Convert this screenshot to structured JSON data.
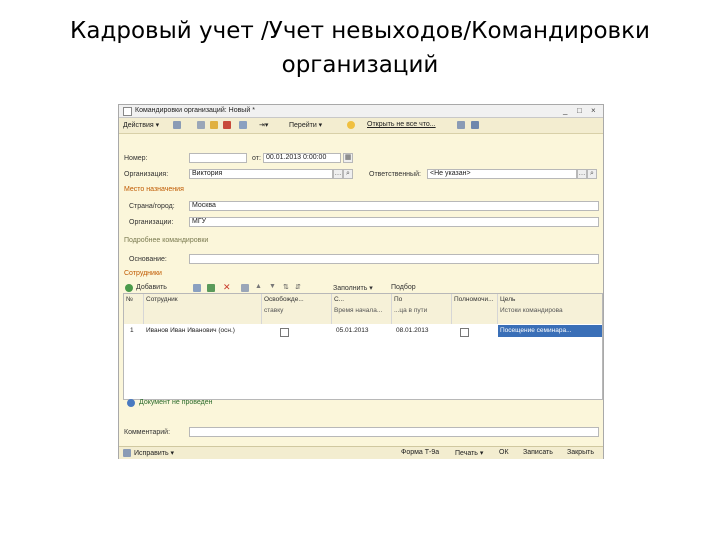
{
  "slide": {
    "title_line1": "Кадровый учет /Учет невыходов/Командировки",
    "title_line2": "организаций"
  },
  "window": {
    "title": "Командировки организаций: Новый *",
    "controls": [
      "_",
      "□",
      "×"
    ]
  },
  "toolbar": {
    "actions_label": "Действия ▾",
    "goto_label": "Перейти ▾",
    "open_label": "Открыть не все что...",
    "help_icon": "help-icon"
  },
  "form": {
    "number_label": "Номер:",
    "number_value": "",
    "from_label": "от:",
    "date_value": "00.01.2013 0:00:00",
    "org_label": "Организация:",
    "org_value": "Виктория",
    "resp_label": "Ответственный:",
    "resp_value": "<Не указан>",
    "place_section": "Место назначения",
    "country_label": "Страна/город:",
    "country_value": "Москва",
    "orgs_label": "Организации:",
    "orgs_value": "МГУ",
    "hint_section": "Подробнее командировки",
    "basis_label": "Основание:",
    "basis_value": ""
  },
  "employees": {
    "section": "Сотрудники",
    "add_label": "Добавить",
    "fill_label": "Заполнить ▾",
    "select_label": "Подбор",
    "columns": [
      {
        "top": "№",
        "bottom": ""
      },
      {
        "top": "Сотрудник",
        "bottom": ""
      },
      {
        "top": "Освобожде...",
        "bottom": "ставку"
      },
      {
        "top": "С...",
        "bottom": "Время начала..."
      },
      {
        "top": "По",
        "bottom": "...ца в пути"
      },
      {
        "top": "Полномочи...",
        "bottom": ""
      },
      {
        "top": "Цель",
        "bottom": "Истоки командирова"
      }
    ],
    "rows": [
      {
        "num": "1",
        "employee": "Иванов Иван Иванович (осн.)",
        "from": "05.01.2013",
        "to": "08.01.2013",
        "goal": "Посещение семинара..."
      }
    ]
  },
  "info_text": "Документ не проведен",
  "comment_label": "Комментарий:",
  "comment_value": "",
  "statusbar": {
    "corrections_label": "Исправить ▾",
    "form_label": "Форма Т-9а",
    "print_label": "Печать ▾",
    "ok_label": "ОК",
    "write_label": "Записать",
    "close_label": "Закрыть"
  },
  "colors": {
    "accent_section": "#c05a00",
    "selection": "#3a6fb7",
    "form_bg": "#fbf6da"
  }
}
